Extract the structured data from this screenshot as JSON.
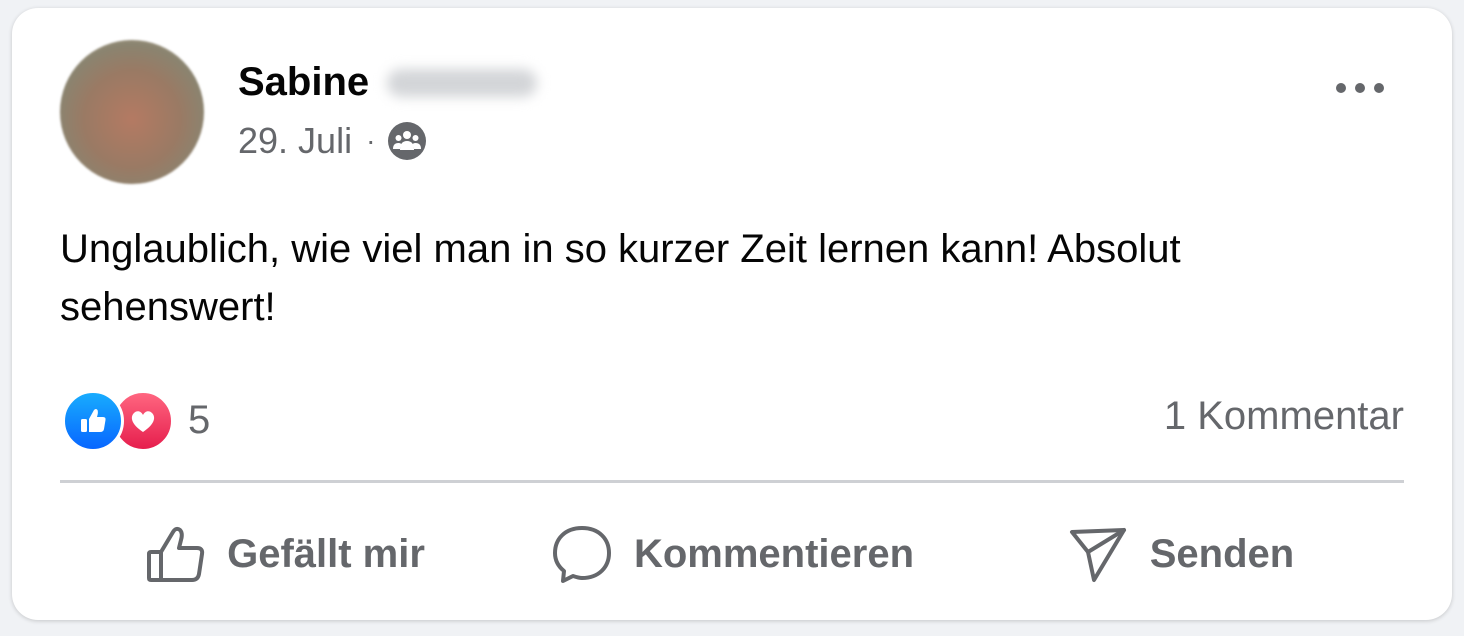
{
  "post": {
    "author_first_name": "Sabine",
    "date": "29. Juli",
    "separator": "·",
    "audience_icon": "group-icon",
    "text": "Unglaublich, wie viel man in so kurzer Zeit lernen kann! Absolut sehenswert!",
    "reactions": {
      "types": [
        "like-icon",
        "love-icon"
      ],
      "count": "5"
    },
    "comments_label": "1 Kommentar"
  },
  "actions": {
    "like_label": "Gefällt mir",
    "comment_label": "Kommentieren",
    "share_label": "Senden"
  },
  "colors": {
    "like_blue": "#0866ff",
    "love_red": "#e61e4d",
    "secondary_text": "#65676b"
  }
}
